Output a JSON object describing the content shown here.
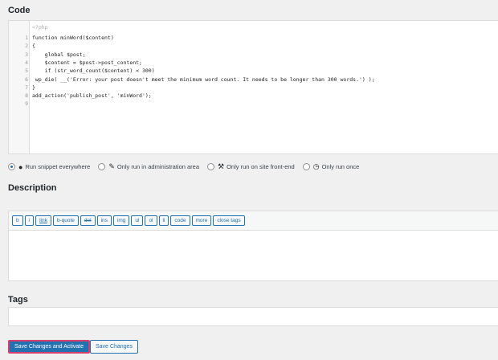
{
  "code_heading": "Code",
  "code": {
    "open_tag": "<?php",
    "lines": [
      {
        "n": "1",
        "text": "function minWord($content)"
      },
      {
        "n": "2",
        "text": "{"
      },
      {
        "n": "3",
        "text": "    global $post;"
      },
      {
        "n": "4",
        "text": "    $content = $post->post_content;"
      },
      {
        "n": "5",
        "text": "    if (str_word_count($content) < 300)"
      },
      {
        "n": "6",
        "text": " wp_die( __('Error: your post doesn't meet the minimum word count. It needs to be longer than 300 words.') );"
      },
      {
        "n": "7",
        "text": "}"
      },
      {
        "n": "8",
        "text": "add_action('publish_post', 'minWord');"
      },
      {
        "n": "9",
        "text": ""
      }
    ]
  },
  "scope_options": [
    {
      "label": "Run snippet everywhere",
      "icon": "globe-icon",
      "checked": true
    },
    {
      "label": "Only run in administration area",
      "icon": "wrench-icon",
      "checked": false
    },
    {
      "label": "Only run on site front-end",
      "icon": "hammer-icon",
      "checked": false
    },
    {
      "label": "Only run once",
      "icon": "clock-icon",
      "checked": false
    }
  ],
  "description_heading": "Description",
  "toolbar": [
    "b",
    "i",
    "link",
    "b-quote",
    "del",
    "ins",
    "img",
    "ul",
    "ol",
    "li",
    "code",
    "more",
    "close tags"
  ],
  "tags_heading": "Tags",
  "buttons": {
    "save_activate": "Save Changes and Activate",
    "save": "Save Changes"
  }
}
